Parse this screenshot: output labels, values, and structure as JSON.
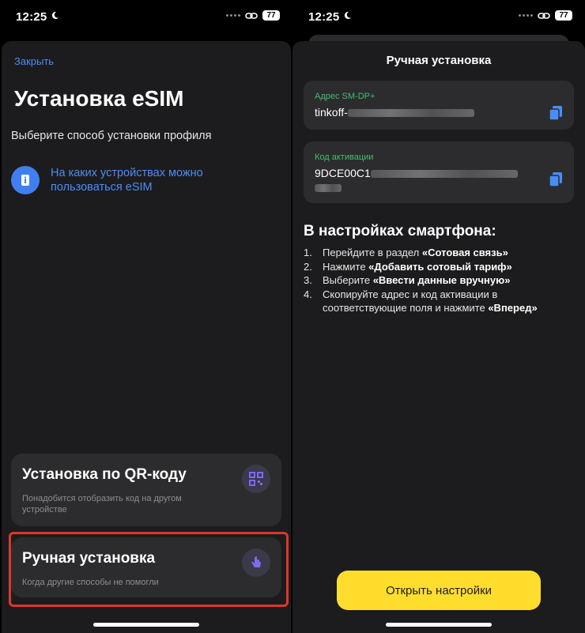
{
  "left": {
    "status_time": "12:25",
    "battery": "77",
    "close": "Закрыть",
    "title": "Установка eSIM",
    "subtitle": "Выберите способ установки профиля",
    "info_link": "На каких устройствах можно пользоваться eSIM",
    "qr_option": {
      "title": "Установка по QR-коду",
      "desc": "Понадобится отобразить код на другом устройстве"
    },
    "manual_option": {
      "title": "Ручная установка",
      "desc": "Когда другие способы не помогли"
    }
  },
  "right": {
    "status_time": "12:25",
    "battery": "77",
    "title": "Ручная установка",
    "sm_dp": {
      "label": "Адрес SM-DP+",
      "value_prefix": "tinkoff-"
    },
    "activation": {
      "label": "Код активации",
      "value_prefix": "9DCE00C1"
    },
    "instructions_title": "В настройках смартфона:",
    "steps": [
      {
        "num": "1.",
        "text": "Перейдите в раздел ",
        "bold": "«Сотовая связь»"
      },
      {
        "num": "2.",
        "text": "Нажмите ",
        "bold": "«Добавить сотовый тариф»"
      },
      {
        "num": "3.",
        "text": "Выберите ",
        "bold": "«Ввести данные вручную»"
      },
      {
        "num": "4.",
        "text": "Скопируйте адрес и код активации в соответствующие поля и нажмите ",
        "bold": "«Вперед»"
      }
    ],
    "open_settings": "Открыть настройки"
  },
  "colors": {
    "accent_blue": "#4a8ef5",
    "label_green": "#3fbf6a",
    "button_yellow": "#ffdd2d",
    "highlight_red": "#e0352b"
  }
}
